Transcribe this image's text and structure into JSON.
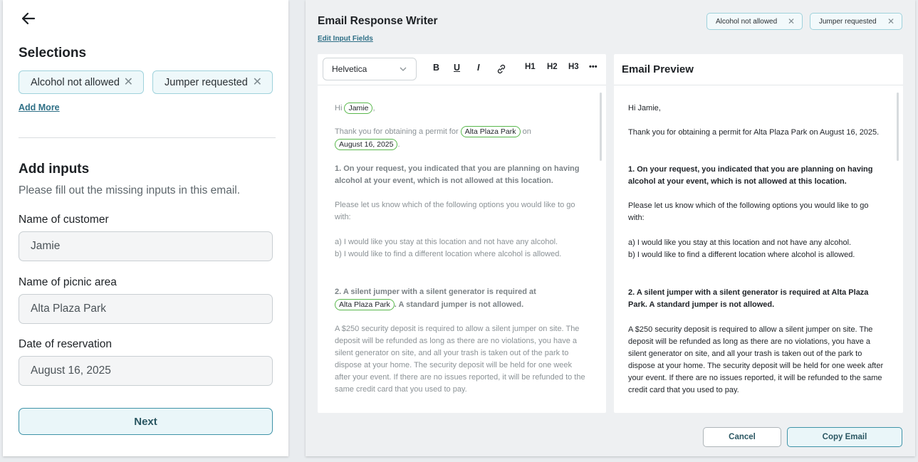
{
  "left": {
    "back_icon": "arrow-left-icon",
    "selections_heading": "Selections",
    "selections": [
      {
        "label": "Alcohol not allowed"
      },
      {
        "label": "Jumper requested"
      }
    ],
    "add_more": "Add More",
    "inputs_heading": "Add inputs",
    "inputs_sub": "Please fill out the missing inputs in this email.",
    "fields": [
      {
        "label": "Name of customer",
        "value": "Jamie"
      },
      {
        "label": "Name of picnic area",
        "value": "Alta Plaza Park"
      },
      {
        "label": "Date of reservation",
        "value": "August 16, 2025"
      }
    ],
    "next": "Next"
  },
  "right": {
    "title": "Email Response Writer",
    "edit_link": "Edit Input Fields",
    "tags": [
      {
        "label": "Alcohol not allowed"
      },
      {
        "label": "Jumper requested"
      }
    ],
    "toolbar": {
      "font": "Helvetica",
      "bold": "B",
      "underline": "U",
      "italic": "I",
      "h1": "H1",
      "h2": "H2",
      "h3": "H3",
      "more": "•••"
    },
    "editor": {
      "greet_pre": "Hi",
      "greet_name": "Jamie",
      "greet_post": ",",
      "thanks_pre": "Thank you for obtaining a permit for",
      "thanks_park": "Alta Plaza Park",
      "thanks_mid": "on",
      "thanks_date": "August 16, 2025",
      "thanks_post": ".",
      "s1": "1.  On your request, you indicated that you are planning on having alcohol at your event, which is not allowed at this location.",
      "s1_ask": "Please let us know which of the following options you would like to go with:",
      "opt_a": "a)  I would like you stay at this location and not have any alcohol.",
      "opt_b": "b)  I would like to find a different location where alcohol is allowed.",
      "s2_pre": "2.  A silent jumper with a silent generator is required at",
      "s2_park": "Alta Plaza Park",
      "s2_post": ".  A standard jumper is not allowed.",
      "deposit": "A $250 security deposit is required to allow a silent jumper on site. The deposit will be refunded as long as there are no violations, you have a silent generator on site, and all your trash is taken out of the park to dispose at your home. The security deposit will be held for one week after your event. If there are no issues reported, it will be refunded to the same credit card that you used to pay."
    },
    "preview": {
      "heading": "Email Preview",
      "greet": "Hi Jamie,",
      "thanks": "Thank you for obtaining a permit for Alta Plaza Park on August 16, 2025.",
      "s1": "1.  On your request, you indicated that you are planning on having alcohol at your event, which is not allowed at this location.",
      "s1_ask": "Please let us know which of the following options you would like to go with:",
      "opt_a": "a)  I would like you stay at this location and not have any alcohol.",
      "opt_b": "b)  I would like to find a different location where alcohol is allowed.",
      "s2": "2.  A silent jumper with a silent generator is required at Alta Plaza Park.  A standard jumper is not allowed.",
      "deposit": "A $250 security deposit is required to allow a silent jumper on site. The deposit will be refunded as long as there are no violations, you have a silent generator on site, and all your trash is taken out of the park to dispose at your home. The security deposit will be held for one week after your event. If there are no issues reported, it will be refunded to the same credit card that you used to pay."
    },
    "cancel": "Cancel",
    "copy": "Copy Email"
  },
  "colors": {
    "accent": "#3f93a8",
    "chip_bg": "#eef8fa",
    "pill_border": "#59b84c"
  }
}
